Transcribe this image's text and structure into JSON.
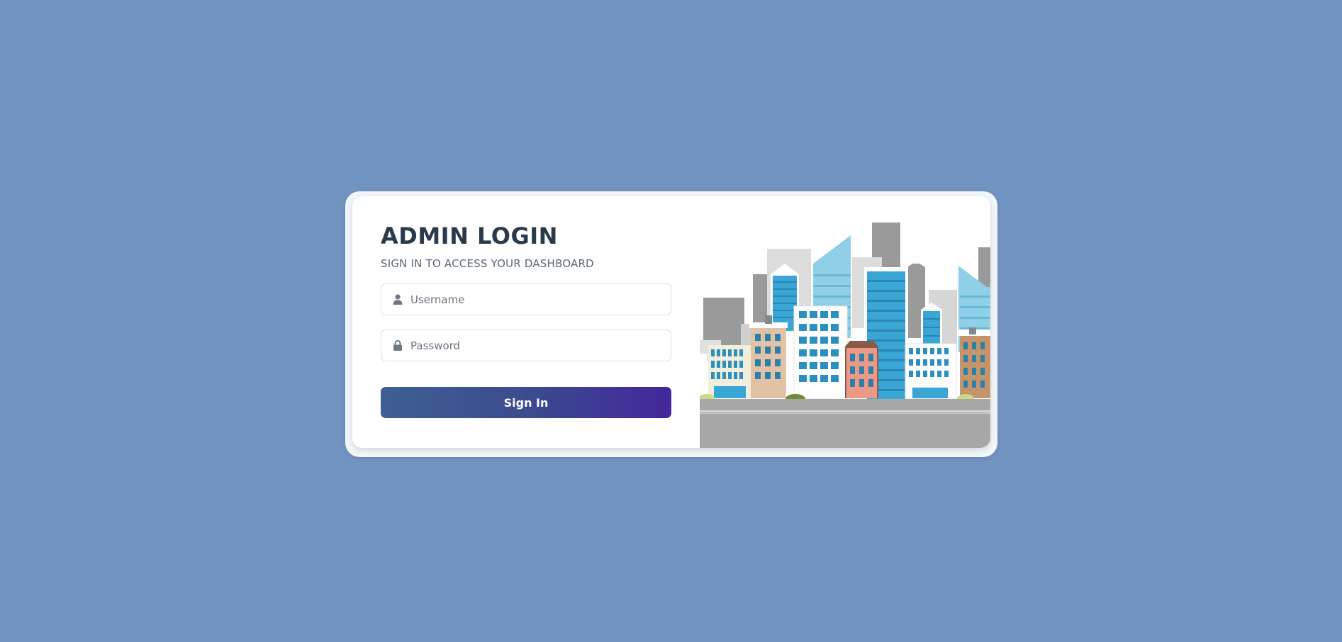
{
  "login": {
    "title": "ADMIN LOGIN",
    "subtitle": "SIGN IN TO ACCESS YOUR DASHBOARD",
    "username_placeholder": "Username",
    "password_placeholder": "Password",
    "submit_label": "Sign In"
  },
  "icons": {
    "username": "user-icon",
    "password": "lock-icon"
  },
  "colors": {
    "page_background": "#7193bf",
    "title": "#2b3a4b",
    "button_gradient_start": "#3f5f94",
    "button_gradient_end": "#42279a",
    "illustration_blue": "#3aa6d6",
    "illustration_gray": "#9a9a9a"
  }
}
